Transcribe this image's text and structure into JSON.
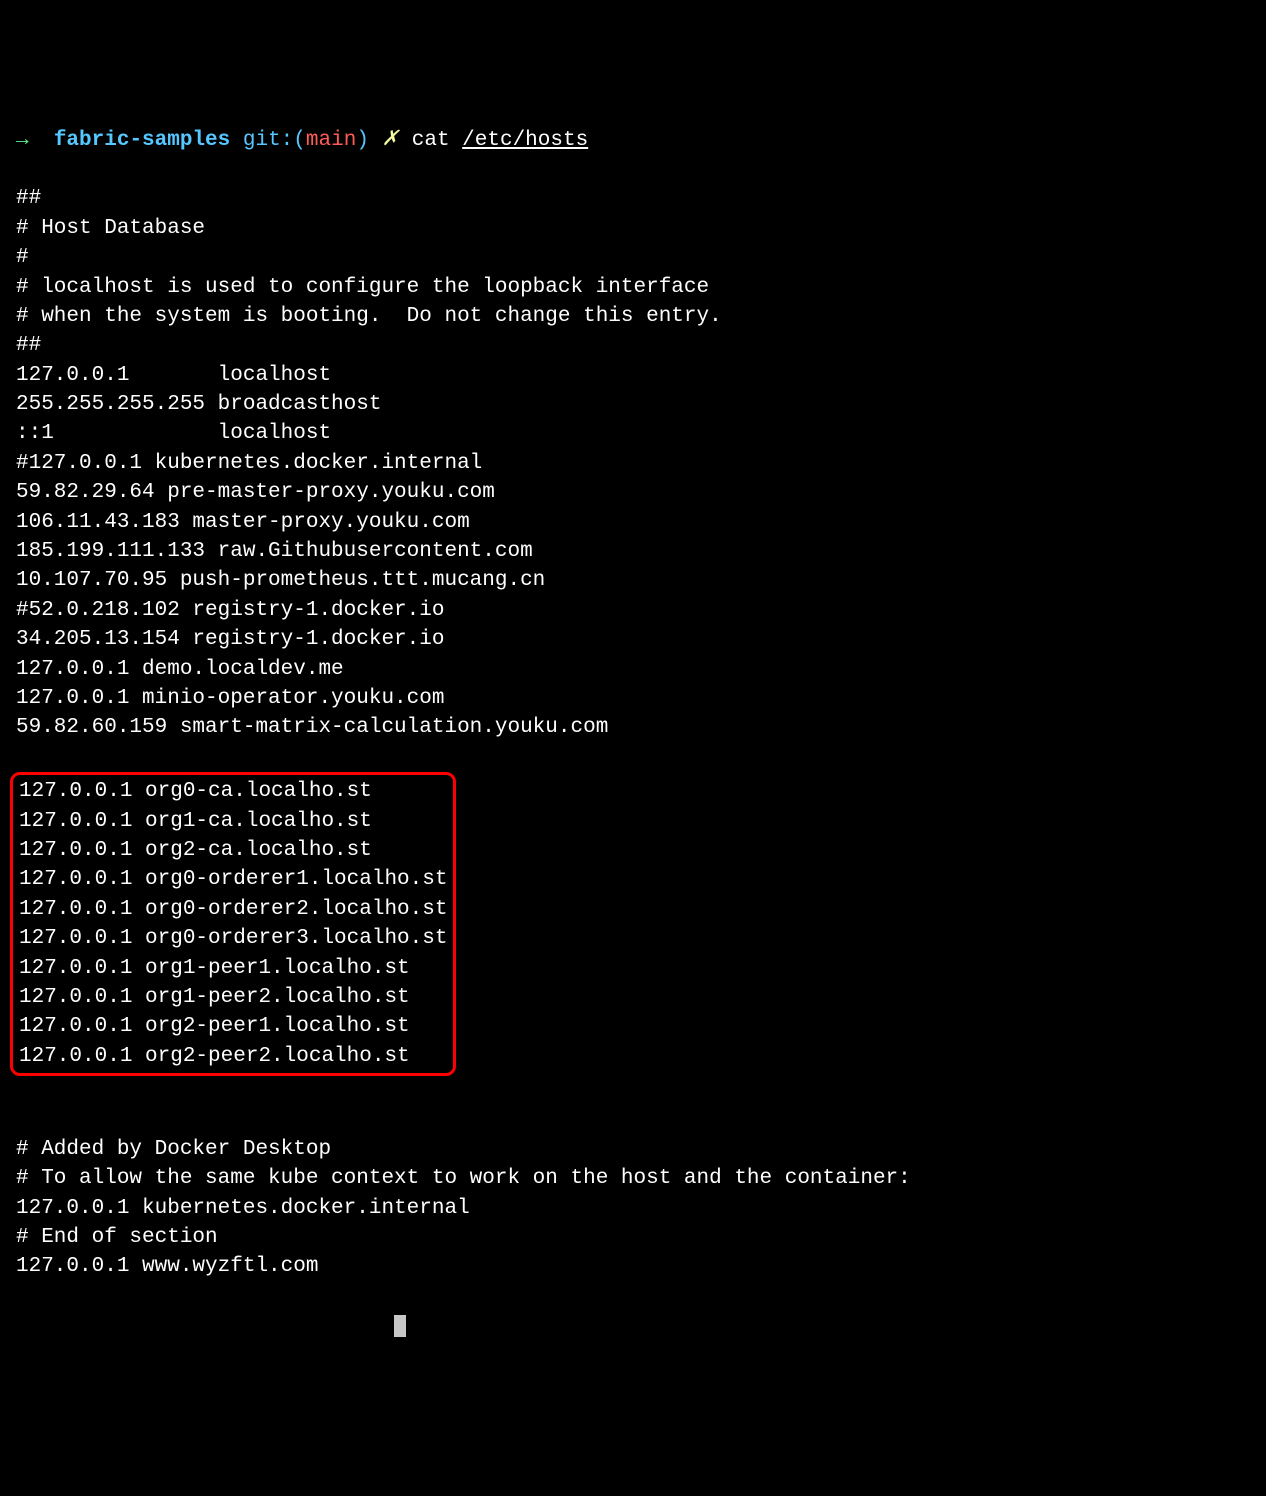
{
  "prompt": {
    "arrow": "→",
    "dir": "fabric-samples",
    "git_prefix": "git:(",
    "git_branch": "main",
    "git_suffix": ")",
    "dirty_marker": "✗",
    "command": "cat",
    "command_arg": "/etc/hosts"
  },
  "output_before": [
    "##",
    "# Host Database",
    "#",
    "# localhost is used to configure the loopback interface",
    "# when the system is booting.  Do not change this entry.",
    "##",
    "127.0.0.1       localhost",
    "255.255.255.255 broadcasthost",
    "::1             localhost",
    "#127.0.0.1 kubernetes.docker.internal",
    "59.82.29.64 pre-master-proxy.youku.com",
    "106.11.43.183 master-proxy.youku.com",
    "185.199.111.133 raw.Githubusercontent.com",
    "10.107.70.95 push-prometheus.ttt.mucang.cn",
    "#52.0.218.102 registry-1.docker.io",
    "34.205.13.154 registry-1.docker.io",
    "127.0.0.1 demo.localdev.me",
    "127.0.0.1 minio-operator.youku.com",
    "59.82.60.159 smart-matrix-calculation.youku.com"
  ],
  "output_highlighted": [
    "127.0.0.1 org0-ca.localho.st",
    "127.0.0.1 org1-ca.localho.st",
    "127.0.0.1 org2-ca.localho.st",
    "127.0.0.1 org0-orderer1.localho.st",
    "127.0.0.1 org0-orderer2.localho.st",
    "127.0.0.1 org0-orderer3.localho.st",
    "127.0.0.1 org1-peer1.localho.st",
    "127.0.0.1 org1-peer2.localho.st",
    "127.0.0.1 org2-peer1.localho.st",
    "127.0.0.1 org2-peer2.localho.st"
  ],
  "output_after": [
    "",
    "",
    "# Added by Docker Desktop",
    "# To allow the same kube context to work on the host and the container:",
    "127.0.0.1 kubernetes.docker.internal",
    "# End of section",
    "127.0.0.1 www.wyzftl.com"
  ]
}
